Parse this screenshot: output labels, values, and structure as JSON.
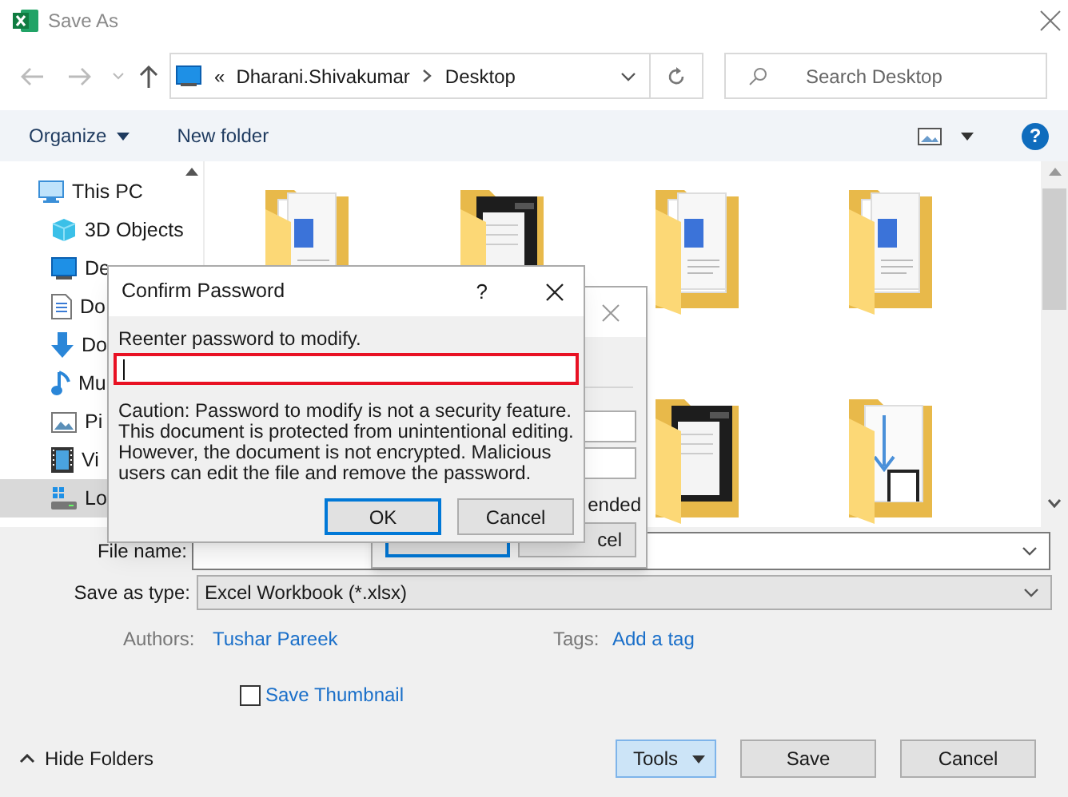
{
  "window": {
    "title": "Save As"
  },
  "address_bar": {
    "overflow": "«",
    "breadcrumbs": [
      "Dharani.Shivakumar",
      "Desktop"
    ]
  },
  "search": {
    "placeholder": "Search Desktop"
  },
  "toolbar": {
    "organize": "Organize",
    "new_folder": "New folder",
    "help": "?"
  },
  "sidebar": {
    "items": [
      {
        "label": "This PC",
        "selected": false,
        "children": [
          {
            "label": "3D Objects",
            "selected": false
          },
          {
            "label": "De",
            "selected": false
          },
          {
            "label": "Do",
            "selected": false
          },
          {
            "label": "Do",
            "selected": false
          },
          {
            "label": "Mu",
            "selected": false
          },
          {
            "label": "Pi",
            "selected": false
          },
          {
            "label": "Vi",
            "selected": false
          },
          {
            "label": "Lo",
            "selected": true
          }
        ]
      }
    ]
  },
  "file_name": {
    "label": "File name:"
  },
  "save_as_type": {
    "label": "Save as type:",
    "value": "Excel Workbook (*.xlsx)"
  },
  "authors": {
    "label": "Authors:",
    "value": "Tushar Pareek"
  },
  "tags": {
    "label": "Tags:",
    "value": "Add a tag"
  },
  "save_thumbnail": {
    "label": "Save Thumbnail",
    "checked": false
  },
  "hide_folders": "Hide Folders",
  "buttons": [
    {
      "label": "Tools",
      "kind": "split"
    },
    {
      "label": "Save",
      "kind": "plain"
    },
    {
      "label": "Cancel",
      "kind": "plain"
    }
  ],
  "general_options": {
    "checkbox_label": "ended",
    "cancel_button": "cel"
  },
  "confirm_password": {
    "title": "Confirm Password",
    "help": "?",
    "prompt": "Reenter password to modify.",
    "caution": "Caution: Password to modify is not a security feature. This document is protected from unintentional editing. However, the document is not encrypted. Malicious users can edit the file and remove the password.",
    "buttons": [
      {
        "label": "OK",
        "selected": true
      },
      {
        "label": "Cancel",
        "selected": false
      }
    ]
  }
}
